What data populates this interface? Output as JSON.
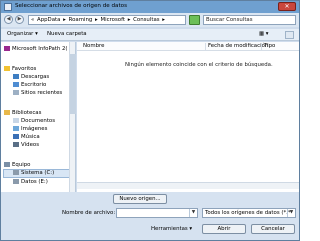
{
  "window": {
    "title": "Seleccionar archivos de origen de datos",
    "close": "✕"
  },
  "address": {
    "breadcrumbs": [
      "«",
      "AppData",
      "▸",
      "Roaming",
      "▸",
      "Microsoft",
      "▸",
      "Consultas",
      "▸"
    ],
    "search_placeholder": "Buscar Consultas"
  },
  "toolbar": {
    "organize": "Organizar ▾",
    "new_folder": "Nueva carpeta",
    "view": "▦ ▾"
  },
  "nav": {
    "top_item": "Microsoft InfoPath 2(",
    "favorites": "Favoritos",
    "favorites_items": [
      "Descargas",
      "Escritorio",
      "Sitios recientes"
    ],
    "libraries": "Bibliotecas",
    "libraries_items": [
      "Documentos",
      "Imágenes",
      "Música",
      "Vídeos"
    ],
    "computer": "Equipo",
    "computer_items": [
      "Sistema (C:)",
      "Datos (E:)"
    ]
  },
  "list": {
    "columns": [
      "Nombre",
      "Fecha de modificación",
      "Tipo"
    ],
    "empty_message": "Ningún elemento coincide con el criterio de búsqueda."
  },
  "bottom": {
    "new_source": "Nuevo origen...",
    "filename_label": "Nombre de archivo:",
    "filename_value": "",
    "filter": "Todos los orígenes de datos (*.*",
    "tools": "Herramientas",
    "open": "Abrir",
    "cancel": "Cancelar"
  }
}
